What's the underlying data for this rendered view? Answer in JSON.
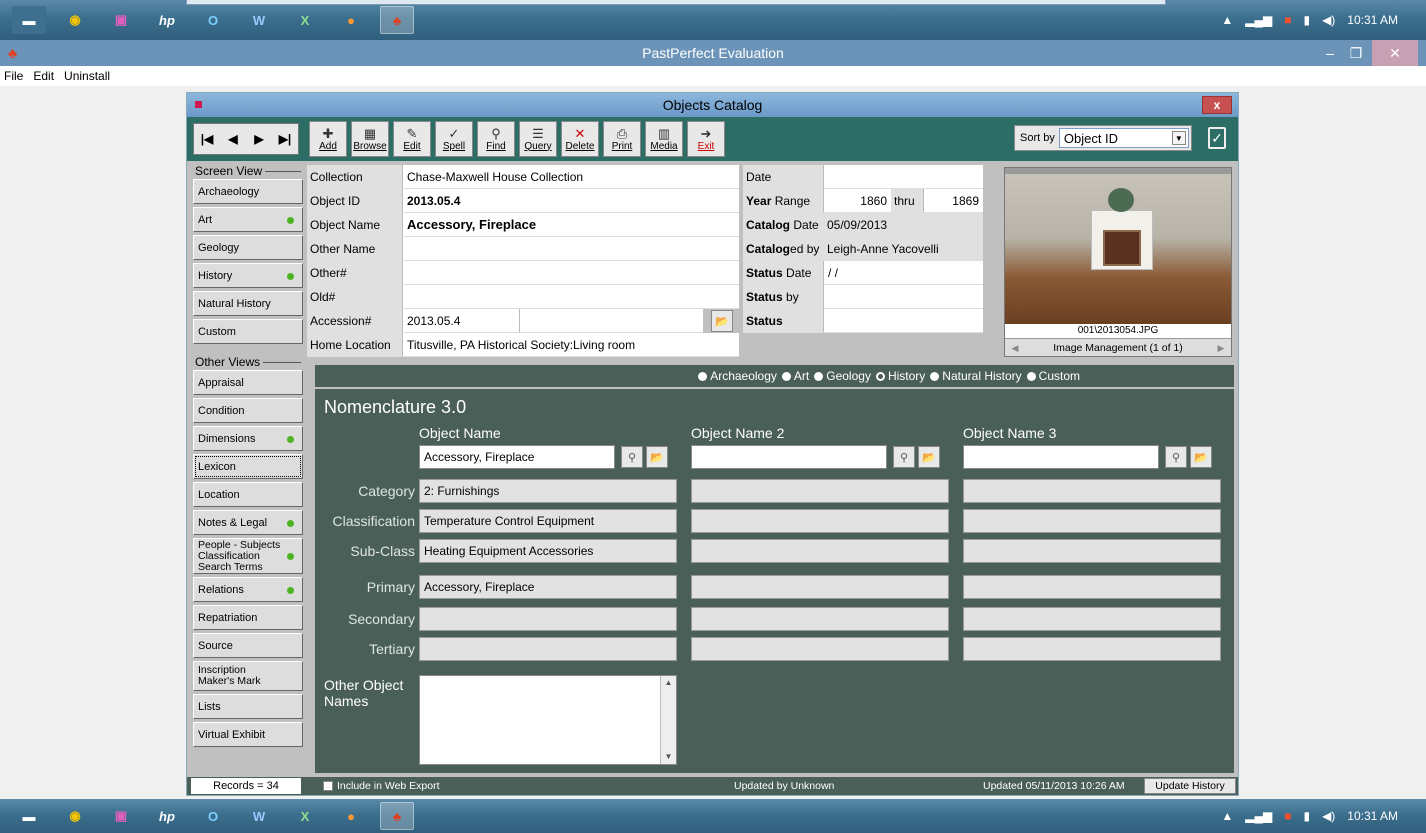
{
  "os": {
    "clock": "10:31 AM",
    "taskbar_apps": [
      "file-explorer",
      "chrome",
      "remote-desktop",
      "hp",
      "outlook",
      "word",
      "excel",
      "firefox",
      "pastperfect"
    ]
  },
  "app": {
    "title": "PastPerfect Evaluation",
    "menu": [
      "File",
      "Edit",
      "Uninstall"
    ]
  },
  "window": {
    "title": "Objects Catalog",
    "close": "x"
  },
  "toolbar": {
    "nav": [
      "|◀",
      "◀",
      "▶",
      "▶|"
    ],
    "buttons": [
      {
        "id": "add",
        "glyph": "✚",
        "label": "Add"
      },
      {
        "id": "browse",
        "glyph": "▦",
        "label": "Browse"
      },
      {
        "id": "edit",
        "glyph": "✎",
        "label": "Edit"
      },
      {
        "id": "spell",
        "glyph": "✓",
        "label": "Spell"
      },
      {
        "id": "find",
        "glyph": "⚲",
        "label": "Find"
      },
      {
        "id": "query",
        "glyph": "☰",
        "label": "Query"
      },
      {
        "id": "delete",
        "glyph": "✕",
        "label": "Delete"
      },
      {
        "id": "print",
        "glyph": "⎙",
        "label": "Print"
      },
      {
        "id": "media",
        "glyph": "▥",
        "label": "Media"
      },
      {
        "id": "exit",
        "glyph": "➜",
        "label": "Exit"
      }
    ],
    "sort_label": "Sort by",
    "sort_value": "Object ID"
  },
  "sidebar": {
    "screen_view_label": "Screen View",
    "screen_views": [
      {
        "label": "Archaeology",
        "dot": false
      },
      {
        "label": "Art",
        "dot": true
      },
      {
        "label": "Geology",
        "dot": false
      },
      {
        "label": "History",
        "dot": true
      },
      {
        "label": "Natural History",
        "dot": false
      },
      {
        "label": "Custom",
        "dot": false
      }
    ],
    "other_views_label": "Other Views",
    "other_views": [
      {
        "label": "Appraisal",
        "dot": false
      },
      {
        "label": "Condition",
        "dot": false
      },
      {
        "label": "Dimensions",
        "dot": true
      },
      {
        "label": "Lexicon",
        "dot": false
      },
      {
        "label": "Location",
        "dot": false
      },
      {
        "label": "Notes & Legal",
        "dot": true
      },
      {
        "label": "People - Subjects\nClassification\nSearch Terms",
        "dot": true
      },
      {
        "label": "Relations",
        "dot": true
      },
      {
        "label": "Repatriation",
        "dot": false
      },
      {
        "label": "Source",
        "dot": false
      },
      {
        "label": "Inscription\nMaker's Mark",
        "dot": false
      },
      {
        "label": "Lists",
        "dot": false
      },
      {
        "label": "Virtual Exhibit",
        "dot": false
      }
    ]
  },
  "record": {
    "collection_label": "Collection",
    "collection": "Chase-Maxwell House Collection",
    "object_id_label": "Object ID",
    "object_id": "2013.05.4",
    "object_name_label": "Object Name",
    "object_name": "Accessory, Fireplace",
    "other_name_label": "Other Name",
    "other_name": "",
    "other_num_label": "Other#",
    "other_num": "",
    "old_num_label": "Old#",
    "old_num": "",
    "accession_label": "Accession#",
    "accession": "2013.05.4",
    "home_location_label": "Home Location",
    "home_location": "Titusville, PA Historical Society:Living room",
    "date_label": "Date",
    "date": "",
    "year_range_label": "Year Range",
    "year_from": "1860",
    "thru_label": "thru",
    "year_to": "1869",
    "catalog_date_label": "Catalog Date",
    "catalog_date": "05/09/2013",
    "cataloged_by_label": "Cataloged by",
    "cataloged_by": "Leigh-Anne Yacovelli",
    "status_date_label": "Status Date",
    "status_date": " /  /",
    "status_by_label": "Status by",
    "status_by": "",
    "status_label": "Status",
    "status": ""
  },
  "image": {
    "filename": "001\\2013054.JPG",
    "management": "Image Management (1 of 1)"
  },
  "view_radio": {
    "options": [
      "Archaeology",
      "Art",
      "Geology",
      "History",
      "Natural History",
      "Custom"
    ],
    "selected": "History"
  },
  "nomenclature": {
    "title": "Nomenclature 3.0",
    "col_headers": [
      "Object Name",
      "Object Name 2",
      "Object Name 3"
    ],
    "names": [
      "Accessory, Fireplace",
      "",
      ""
    ],
    "row_labels": [
      "Category",
      "Classification",
      "Sub-Class",
      "Primary",
      "Secondary",
      "Tertiary"
    ],
    "col1": [
      "2: Furnishings",
      "Temperature Control Equipment",
      "Heating Equipment Accessories",
      "Accessory, Fireplace",
      "",
      ""
    ],
    "other_label": "Other Object\nNames",
    "other_value": ""
  },
  "status": {
    "records": "Records = 34",
    "web_export": "Include in Web Export",
    "updated_by": "Updated by  Unknown",
    "updated": "Updated   05/11/2013 10:26 AM",
    "update_history": "Update History"
  }
}
